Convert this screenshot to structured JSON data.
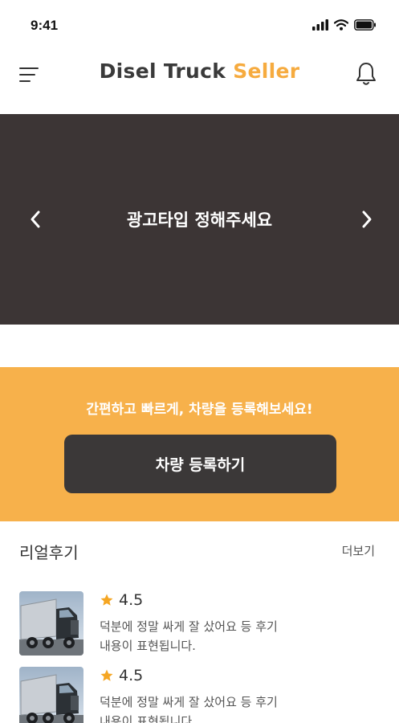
{
  "status_bar": {
    "time": "9:41",
    "icons": [
      "signal-icon",
      "wifi-icon",
      "battery-icon"
    ]
  },
  "header": {
    "title_main": "Disel Truck",
    "title_accent": "Seller",
    "left_icon": "menu-icon",
    "right_icon": "bell-icon"
  },
  "banner": {
    "text": "광고타입 정해주세요",
    "prev_icon": "chevron-left-icon",
    "next_icon": "chevron-right-icon"
  },
  "cta": {
    "text": "간편하고 빠르게, 차량을 등록해보세요!",
    "button_label": "차량 등록하기"
  },
  "reviews": {
    "title": "리얼후기",
    "more_label": "더보기",
    "items": [
      {
        "rating": "4.5",
        "text": "덕분에 정말 싸게 잘 샀어요 등 후기 내용이 표현됩니다."
      },
      {
        "rating": "4.5",
        "text": "덕분에 정말 싸게 잘 샀어요 등 후기 내용이 표현됩니다."
      }
    ]
  },
  "colors": {
    "accent": "#f6ab3f",
    "cta_background": "#f7b14b",
    "banner_background": "#3c3535",
    "button_dark": "#3b3838",
    "star": "#f5a623"
  }
}
